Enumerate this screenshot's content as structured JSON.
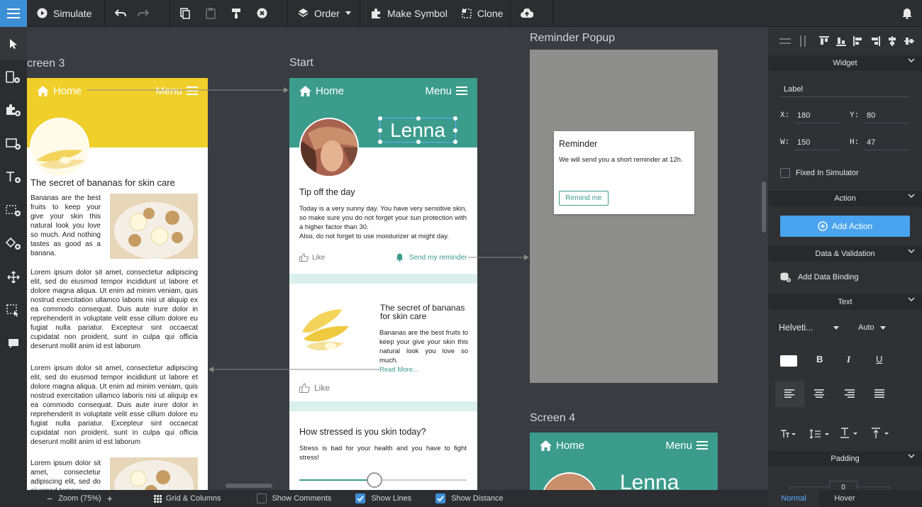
{
  "toolbar": {
    "simulate": "Simulate",
    "order": "Order",
    "make_symbol": "Make Symbol",
    "clone": "Clone"
  },
  "screens": {
    "screen3": {
      "title": "creen 3",
      "home": "Home",
      "menu": "Menu",
      "article_title": "The secret of bananas for skin care",
      "article_intro": "Bananas are the best fruits to keep your give your skin this natural look you love so much. And nothing tastes as good as a banana.",
      "lorem1": "Lorem ipsum dolor sit amet, consectetur adipiscing elit, sed do eiusmod tempor incididunt ut labore et dolore magna aliqua. Ut enim ad minim veniam, quis nostrud exercitation ullamco laboris nisi ut aliquip ex ea commodo consequat. Duis aute irure dolor in reprehenderit in voluptate velit esse cillum dolore eu fugiat nulla pariatur. Excepteur sint occaecat cupidatat non proident, sunt in culpa qui officia deserunt mollit anim id est laborum",
      "lorem2": "Lorem ipsum dolor sit amet, consectetur adipiscing elit, sed do eiusmod tempor incididunt ut labore et dolore magna aliqua. Ut enim ad minim veniam, quis nostrud exercitation ullamco laboris nisi ut aliquip ex ea commodo consequat. Duis aute irure dolor in reprehenderit in voluptate velit esse cillum dolore eu fugiat nulla pariatur. Excepteur sint occaecat cupidatat non proident, sunt in culpa qui officia deserunt mollit anim id est laborum",
      "lorem3": "Lorem ipsum dolor sit amet, consectetur adipiscing elit, sed do eiusmod tempor"
    },
    "start": {
      "title": "Start",
      "home": "Home",
      "menu": "Menu",
      "name": "Lenna",
      "tip_title": "Tip off the day",
      "tip_text": "Today is a very sunny day. You have very sensitive skin, so make sure you do not forget your sun protection with a higher factor than 30.",
      "tip_text2": "Also, do not forget to use moisturizer at might day.",
      "like": "Like",
      "send_reminder": "Send my reminder",
      "card_title": "The secret of bananas for skin care",
      "card_text": "Bananas are the best fruits to keep your give your skin this natural look you love so much.",
      "read_more": "Read More...",
      "like2": "Like",
      "stress_title": "How stressed is you skin today?",
      "stress_text": "Stress is bad for your health and you have to fight stress!",
      "stress_level": 0.45
    },
    "reminder": {
      "title": "Reminder Popup",
      "popup_title": "Reminder",
      "popup_text": "We will send you a short reminder at 12h.",
      "button": "Remind me"
    },
    "screen4": {
      "title": "Screen 4",
      "home": "Home",
      "menu": "Menu",
      "name": "Lenna"
    }
  },
  "bottombar": {
    "zoom": "Zoom (75%)",
    "grid": "Grid & Columns",
    "show_comments": "Show Comments",
    "show_lines": "Show Lines",
    "show_distance": "Show Distance"
  },
  "panel": {
    "widget": "Widget",
    "label_value": "Label",
    "x_label": "X:",
    "x_value": "180",
    "y_label": "Y:",
    "y_value": "80",
    "w_label": "W:",
    "w_value": "150",
    "h_label": "H:",
    "h_value": "47",
    "fixed": "Fixed In Simulator",
    "action": "Action",
    "add_action": "Add Action",
    "data_validation": "Data & Validation",
    "add_binding": "Add Data Binding",
    "text": "Text",
    "font": "Helveti...",
    "size": "Auto",
    "bold": "B",
    "italic": "I",
    "underline": "U",
    "padding": "Padding",
    "padding_value": "0",
    "state_normal": "Normal",
    "state_hover": "Hover"
  },
  "colors": {
    "accent": "#3d8fd6",
    "teal": "#3c9c8c",
    "yellow": "#f0cf2a",
    "dark": "#2b2d30"
  }
}
